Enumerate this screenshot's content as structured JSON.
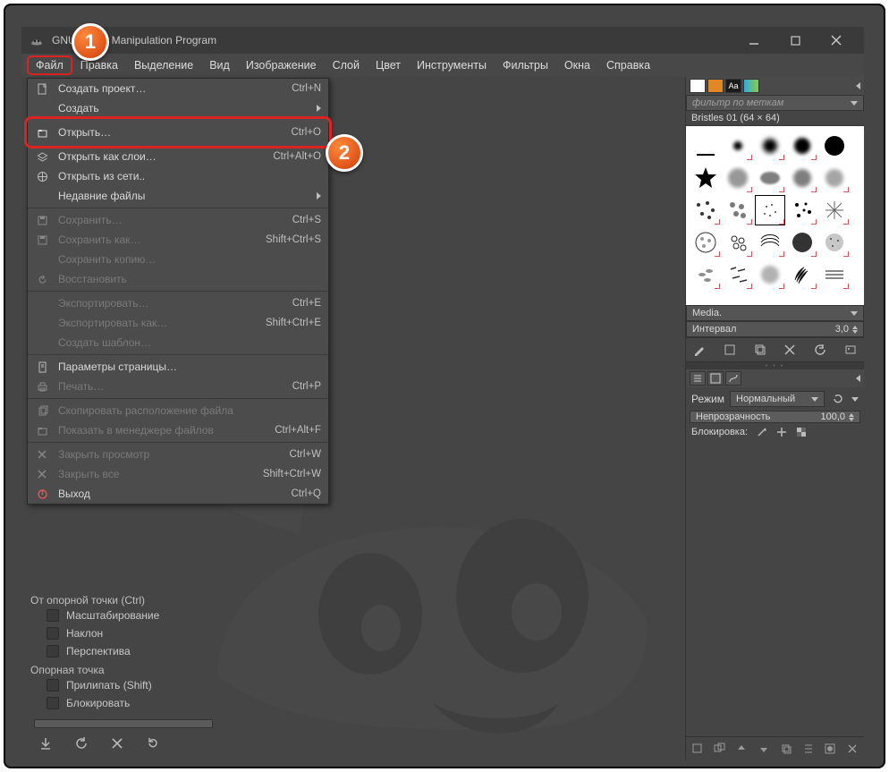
{
  "title": "GNU Image Manipulation Program",
  "menubar": [
    "Файл",
    "Правка",
    "Выделение",
    "Вид",
    "Изображение",
    "Слой",
    "Цвет",
    "Инструменты",
    "Фильтры",
    "Окна",
    "Справка"
  ],
  "dropdown": {
    "groups": [
      [
        {
          "icon": "doc",
          "label": "Создать проект…",
          "accel": "Ctrl+N"
        },
        {
          "icon": "",
          "label": "Создать",
          "sub": true
        },
        {
          "icon": "open",
          "label": "Открыть…",
          "accel": "Ctrl+O",
          "hl": true
        },
        {
          "icon": "layers",
          "label": "Открыть как слои…",
          "accel": "Ctrl+Alt+O"
        },
        {
          "icon": "net",
          "label": "Открыть из сети..",
          "accel": ""
        },
        {
          "icon": "",
          "label": "Недавние файлы",
          "sub": true
        }
      ],
      [
        {
          "icon": "save",
          "label": "Сохранить…",
          "accel": "Ctrl+S",
          "dis": true
        },
        {
          "icon": "save",
          "label": "Сохранить как…",
          "accel": "Shift+Ctrl+S",
          "dis": true
        },
        {
          "icon": "",
          "label": "Сохранить копию…",
          "accel": "",
          "dis": true
        },
        {
          "icon": "revert",
          "label": "Восстановить",
          "accel": "",
          "dis": true
        }
      ],
      [
        {
          "icon": "",
          "label": "Экспортировать…",
          "accel": "Ctrl+E",
          "dis": true
        },
        {
          "icon": "",
          "label": "Экспортировать как…",
          "accel": "Shift+Ctrl+E",
          "dis": true
        },
        {
          "icon": "",
          "label": "Создать шаблон…",
          "accel": "",
          "dis": true
        }
      ],
      [
        {
          "icon": "page",
          "label": "Параметры страницы…",
          "accel": ""
        },
        {
          "icon": "print",
          "label": "Печать…",
          "accel": "Ctrl+P",
          "dis": true
        }
      ],
      [
        {
          "icon": "copy",
          "label": "Скопировать расположение файла",
          "accel": "",
          "dis": true
        },
        {
          "icon": "folder",
          "label": "Показать в менеджере файлов",
          "accel": "Ctrl+Alt+F",
          "dis": true
        }
      ],
      [
        {
          "icon": "close",
          "label": "Закрыть просмотр",
          "accel": "Ctrl+W",
          "dis": true
        },
        {
          "icon": "close",
          "label": "Закрыть все",
          "accel": "Shift+Ctrl+W",
          "dis": true
        },
        {
          "icon": "quit",
          "label": "Выход",
          "accel": "Ctrl+Q"
        }
      ]
    ]
  },
  "leftpanel": {
    "anchor_title": "От опорной точки  (Ctrl)",
    "opts1": [
      "Масштабирование",
      "Наклон",
      "Перспектива"
    ],
    "anchor2": "Опорная точка",
    "opts2": [
      "Прилипать  (Shift)",
      "Блокировать"
    ]
  },
  "right": {
    "filter_placeholder": "фильтр по меткам",
    "brush_caption": "Bristles 01 (64 × 64)",
    "media": "Media.",
    "interval": "Интервал",
    "interval_val": "3,0",
    "tabs_aa": "Aa",
    "mode_lbl": "Режим",
    "mode_val": "Нормальный",
    "opacity_lbl": "Непрозрачность",
    "opacity_val": "100,0",
    "lock_lbl": "Блокировка:"
  },
  "badges": {
    "one": "1",
    "two": "2"
  }
}
